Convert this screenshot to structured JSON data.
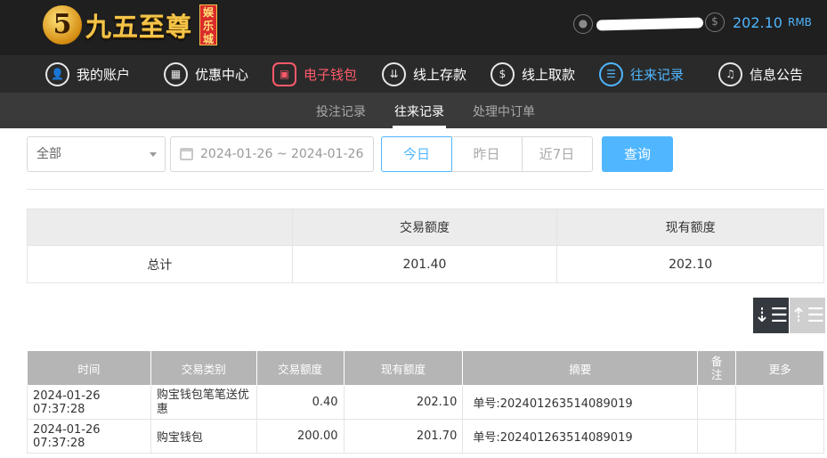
{
  "header": {
    "logo_mark": "5",
    "logo_text": "九五至尊",
    "logo_tag": "娱乐城",
    "balance": "202.10",
    "balance_unit": "RMB"
  },
  "main_nav": [
    {
      "label": "我的账户",
      "icon": "user-icon"
    },
    {
      "label": "优惠中心",
      "icon": "gift-icon"
    },
    {
      "label": "电子钱包",
      "icon": "wallet-icon"
    },
    {
      "label": "线上存款",
      "icon": "deposit-icon"
    },
    {
      "label": "线上取款",
      "icon": "withdraw-icon"
    },
    {
      "label": "往来记录",
      "icon": "records-icon"
    },
    {
      "label": "信息公告",
      "icon": "bell-icon"
    }
  ],
  "sub_nav": [
    {
      "label": "投注记录"
    },
    {
      "label": "往来记录"
    },
    {
      "label": "处理中订单"
    }
  ],
  "filters": {
    "type_value": "全部",
    "date_range": "2024-01-26 ~ 2024-01-26",
    "quick": [
      "今日",
      "昨日",
      "近7日"
    ],
    "query_label": "查询"
  },
  "summary": {
    "headers": [
      "",
      "交易额度",
      "现有额度"
    ],
    "row": [
      "总计",
      "201.40",
      "202.10"
    ]
  },
  "sort": {
    "desc_icon": "sort-desc-icon",
    "asc_icon": "sort-asc-icon"
  },
  "records": {
    "headers": [
      "时间",
      "交易类别",
      "交易额度",
      "现有额度",
      "摘要",
      "备注",
      "更多"
    ],
    "rows": [
      [
        "2024-01-26 07:37:28",
        "购宝钱包笔笔送优惠",
        "0.40",
        "202.10",
        "单号:202401263514089019",
        "",
        ""
      ],
      [
        "2024-01-26 07:37:28",
        "购宝钱包",
        "200.00",
        "201.70",
        "单号:202401263514089019",
        "",
        ""
      ]
    ]
  },
  "colors": {
    "accent": "#4fb6ff",
    "active_wallet": "#ff5a6b",
    "header_bg": "#1f1f1f"
  }
}
